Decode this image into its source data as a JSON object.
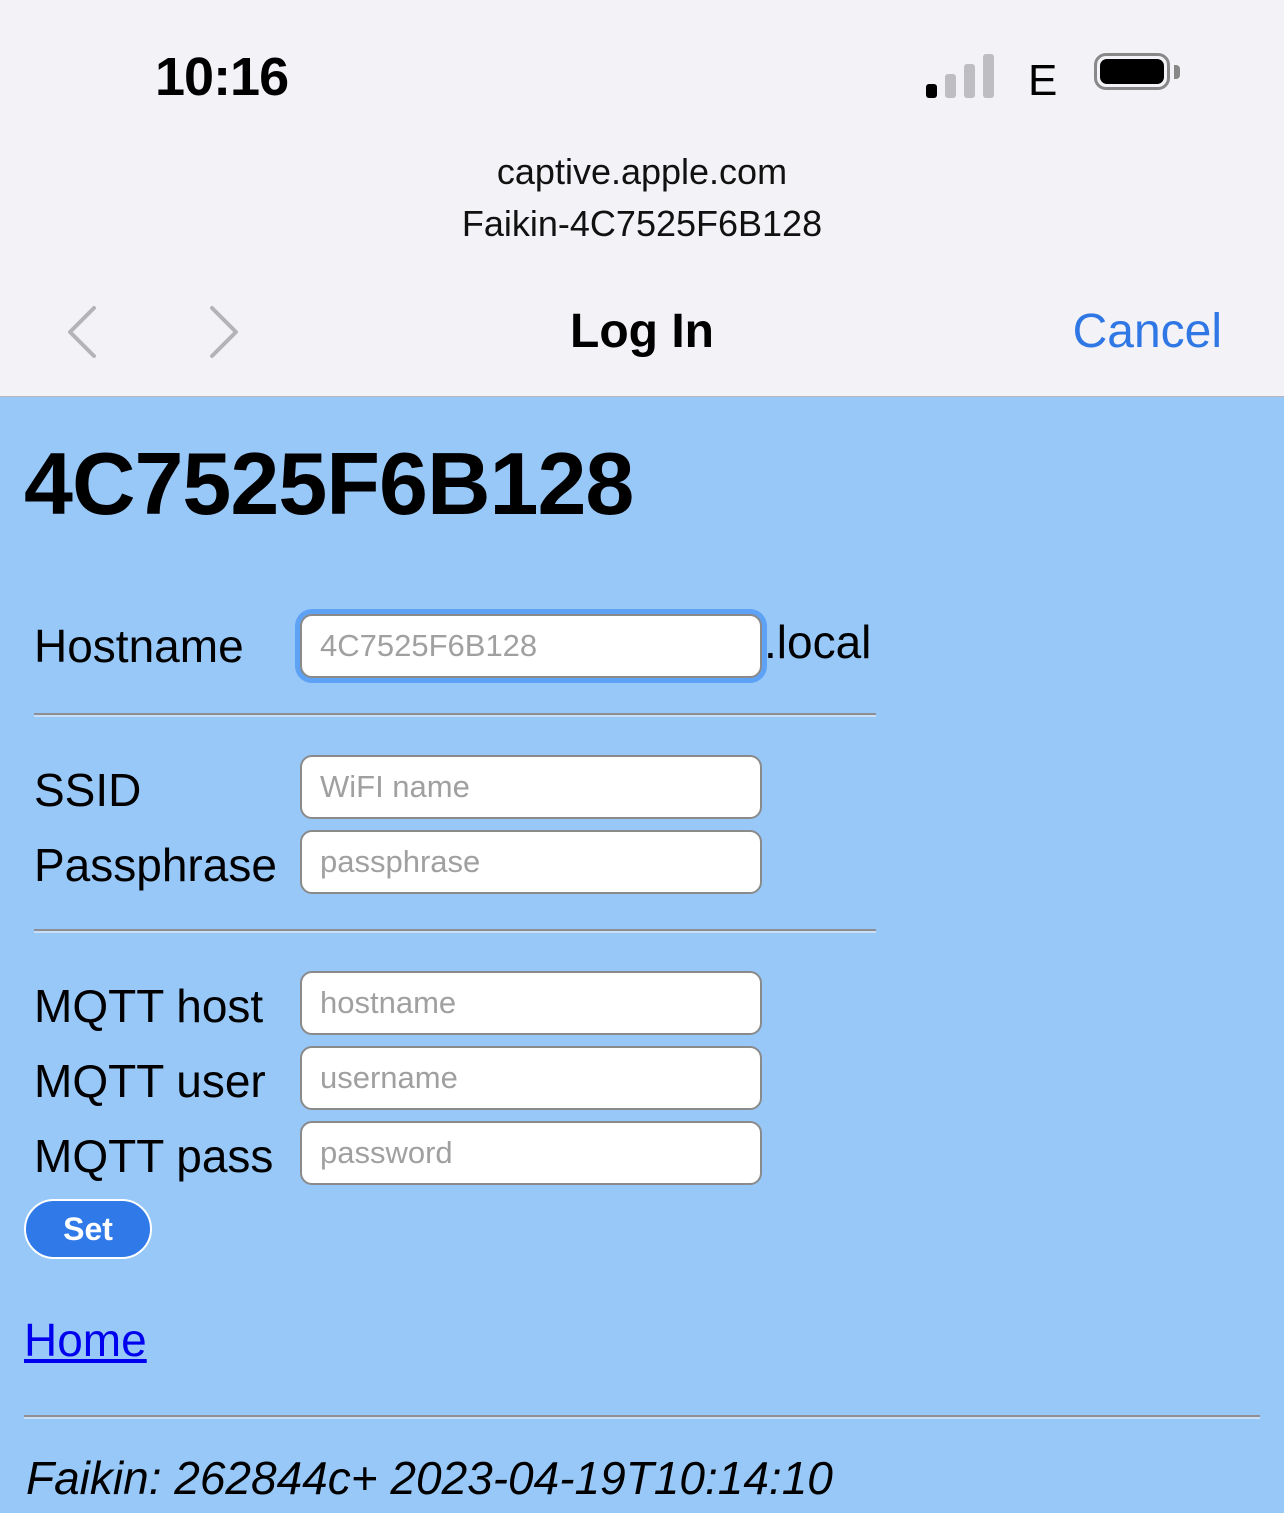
{
  "status_bar": {
    "time": "10:16",
    "network": "E",
    "signal_bars_active": 1,
    "signal_bars_total": 4,
    "icons": [
      "signal-strength-icon",
      "battery-icon"
    ]
  },
  "url_bar": {
    "domain": "captive.apple.com",
    "ssid": "Faikin-4C7525F6B128"
  },
  "nav": {
    "title": "Log In",
    "cancel_label": "Cancel",
    "icons": [
      "back-chevron-icon",
      "forward-chevron-icon"
    ]
  },
  "page": {
    "heading": "4C7525F6B128",
    "hostname": {
      "label": "Hostname",
      "placeholder": "4C7525F6B128",
      "value": "",
      "suffix": ".local"
    },
    "ssid": {
      "label": "SSID",
      "placeholder": "WiFI name",
      "value": ""
    },
    "passphrase": {
      "label": "Passphrase",
      "placeholder": "passphrase",
      "value": ""
    },
    "mqtt_host": {
      "label": "MQTT host",
      "placeholder": "hostname",
      "value": ""
    },
    "mqtt_user": {
      "label": "MQTT user",
      "placeholder": "username",
      "value": ""
    },
    "mqtt_pass": {
      "label": "MQTT pass",
      "placeholder": "password",
      "value": ""
    },
    "set_label": "Set",
    "home_label": "Home",
    "footer": "Faikin: 262844c+ 2023-04-19T10:14:10"
  },
  "colors": {
    "page_background": "#98c8f8",
    "chrome_background": "#f2f2f7",
    "accent": "#2f77e4",
    "button": "#3079e8",
    "link": "#0000ee"
  }
}
